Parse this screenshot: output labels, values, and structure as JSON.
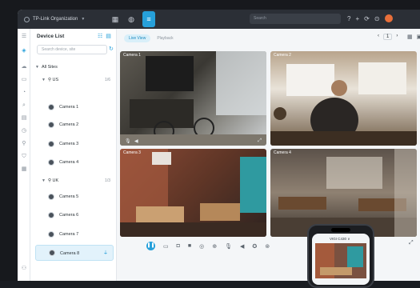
{
  "topbar": {
    "org_name": "TP-Link Organization",
    "search_placeholder": "Search",
    "accent": "#26a0da"
  },
  "rail_icons": [
    "menu-icon",
    "omada-logo-icon",
    "cloud-icon",
    "camera-icon",
    "alarm-icon",
    "search-icon",
    "list-icon",
    "clock-icon",
    "location-icon",
    "shield-icon",
    "grid-icon",
    "user-icon"
  ],
  "panel": {
    "title": "Device List",
    "search_placeholder": "Search device, site",
    "all_sites": "All Sites",
    "sites": [
      {
        "name": "US",
        "count": "1/6",
        "cameras": [
          "Camera 1",
          "Camera 2",
          "Camera 3",
          "Camera 4"
        ]
      },
      {
        "name": "UK",
        "count": "1/3",
        "cameras": [
          "Camera 5",
          "Camera 6",
          "Camera 7",
          "Camera 8"
        ]
      }
    ],
    "selected_camera": "Camera 8"
  },
  "main": {
    "tabs": [
      "Live View",
      "Playback"
    ],
    "active_tab": "Live View",
    "page": "1",
    "tiles": [
      {
        "name": "Camera 1"
      },
      {
        "name": "Camera 2"
      },
      {
        "name": "Camera 3"
      },
      {
        "name": "Camera 4"
      }
    ]
  },
  "phone": {
    "camera_name": "VIGI C430 ∨"
  }
}
